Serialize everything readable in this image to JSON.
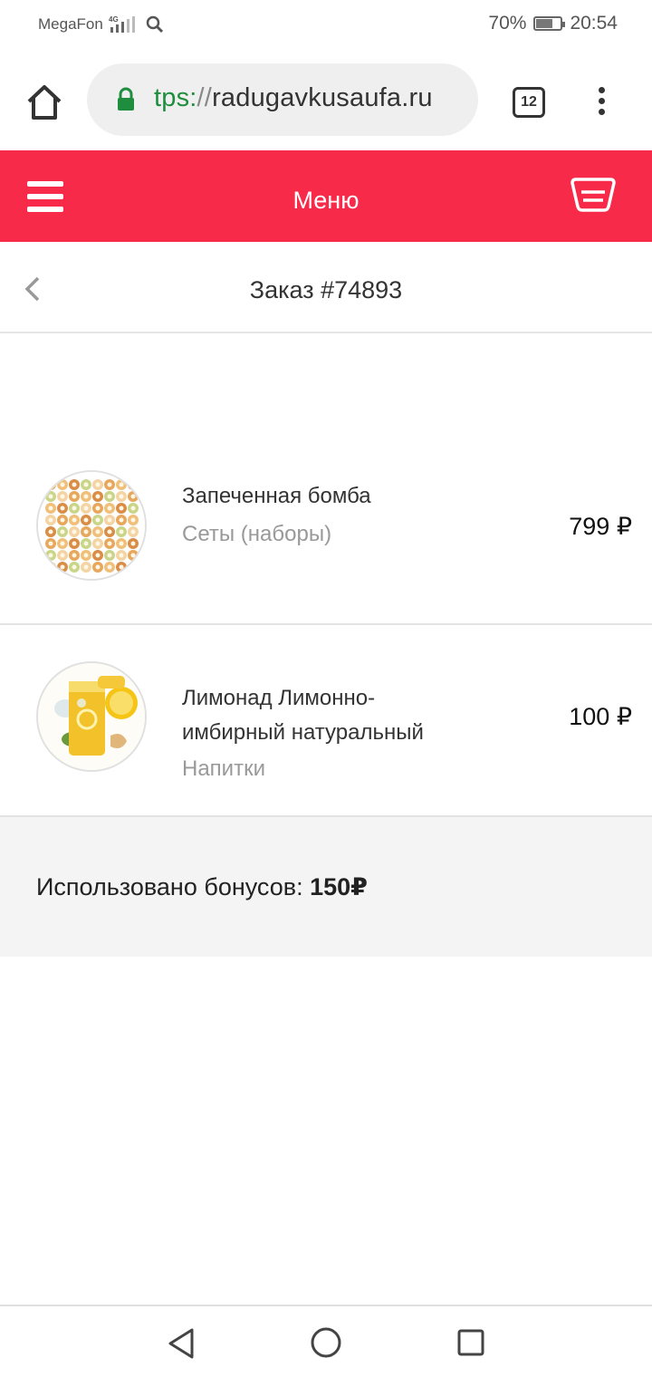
{
  "status_bar": {
    "carrier": "MegaFon",
    "network": "4G",
    "battery": "70%",
    "battery_level": 0.7,
    "time": "20:54"
  },
  "browser": {
    "url_scheme": "tps:",
    "url_sep": "//",
    "url_host": "radugavkusaufa.ru",
    "tabs_count": "12"
  },
  "header": {
    "title": "Меню",
    "accent_color": "#f72a4a"
  },
  "order": {
    "title": "Заказ #74893"
  },
  "items": [
    {
      "name": "Запеченная бомба",
      "category": "Сеты (наборы)",
      "price": "799 ₽",
      "image": "sushi-set-image"
    },
    {
      "name": "Лимонад Лимонно-имбирный натуральный",
      "category": "Напитки",
      "price": "100 ₽",
      "image": "lemonade-image"
    }
  ],
  "bonus": {
    "label": "Использовано бонусов: ",
    "value": "150₽"
  },
  "navbar": {
    "icons": [
      "back-triangle-icon",
      "home-circle-icon",
      "recents-square-icon"
    ]
  }
}
